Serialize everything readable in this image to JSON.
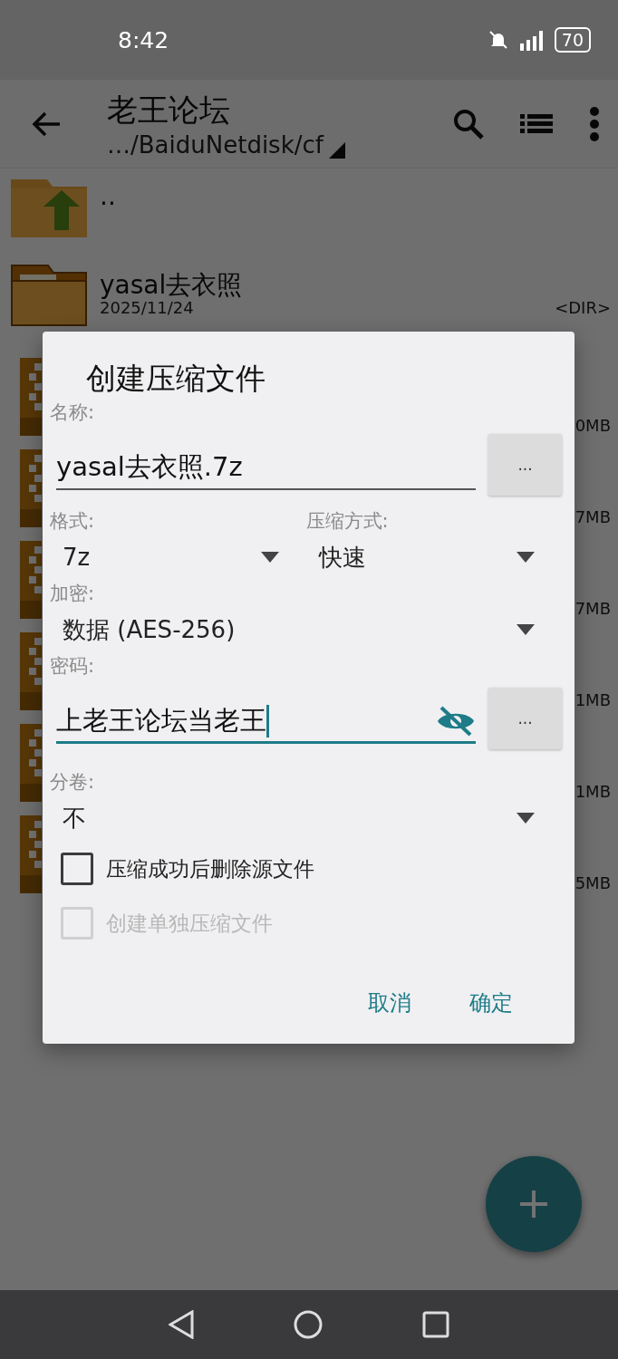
{
  "status_bar": {
    "time": "8:42",
    "battery": "70"
  },
  "toolbar": {
    "title": "老王论坛",
    "path": "…/BaiduNetdisk/cf"
  },
  "files": [
    {
      "kind": "parent",
      "name": ".."
    },
    {
      "kind": "folder",
      "name": "yasal去衣照",
      "date": "2025/11/24",
      "size": "<DIR>"
    },
    {
      "kind": "archive",
      "size": "0MB"
    },
    {
      "kind": "archive",
      "size": "7MB"
    },
    {
      "kind": "archive",
      "size": "7MB"
    },
    {
      "kind": "archive",
      "size": "1MB"
    },
    {
      "kind": "archive",
      "size": "1MB"
    },
    {
      "kind": "archive",
      "size": "5MB"
    }
  ],
  "dialog": {
    "title": "创建压缩文件",
    "name_label": "名称:",
    "name_value": "yasal去衣照.7z",
    "name_button": "...",
    "format_label": "格式:",
    "format_value": "7z",
    "method_label": "压缩方式:",
    "method_value": "快速",
    "encryption_label": "加密:",
    "encryption_value": "数据 (AES-256)",
    "password_label": "密码:",
    "password_value": "上老王论坛当老王",
    "password_visible": true,
    "password_focused": true,
    "password_button": "...",
    "split_label": "分卷:",
    "split_value": "不",
    "options": [
      {
        "label": "压缩成功后删除源文件",
        "checked": false,
        "disabled": false
      },
      {
        "label": "创建单独压缩文件",
        "checked": false,
        "disabled": true
      }
    ],
    "buttons": [
      "取消",
      "确定"
    ]
  }
}
